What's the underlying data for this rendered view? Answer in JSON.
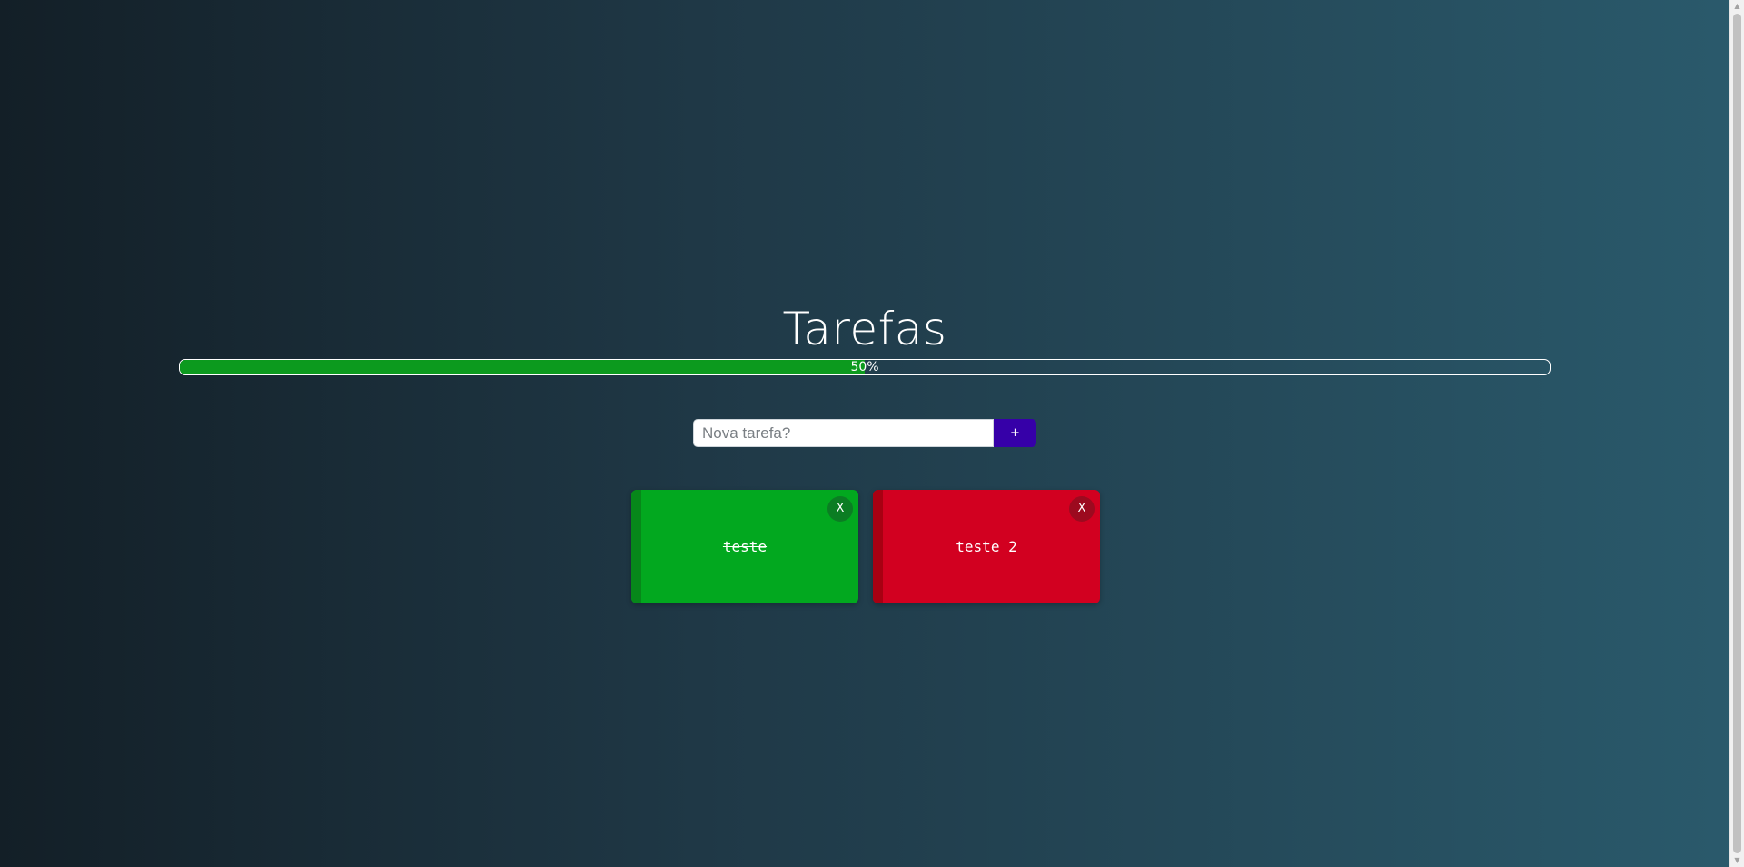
{
  "app": {
    "title": "Tarefas"
  },
  "progress": {
    "value": 0.5,
    "label": "50%",
    "fill_color": "#0c9a1e"
  },
  "form": {
    "input_placeholder": "Nova tarefa?",
    "input_value": "",
    "add_label": "+",
    "add_color": "#3600a8"
  },
  "tasks": [
    {
      "text": "teste",
      "done": true,
      "close_label": "X",
      "bg_color": "#02a81f",
      "bar_color": "#07871a",
      "close_bg": "#0b7d23"
    },
    {
      "text": "teste 2",
      "done": false,
      "close_label": "X",
      "bg_color": "#d20020",
      "bar_color": "#a80012",
      "close_bg": "#9c0a1f"
    }
  ],
  "scrollbar": {
    "up_icon": "scroll-up-arrow-icon",
    "down_icon": "scroll-down-arrow-icon"
  }
}
